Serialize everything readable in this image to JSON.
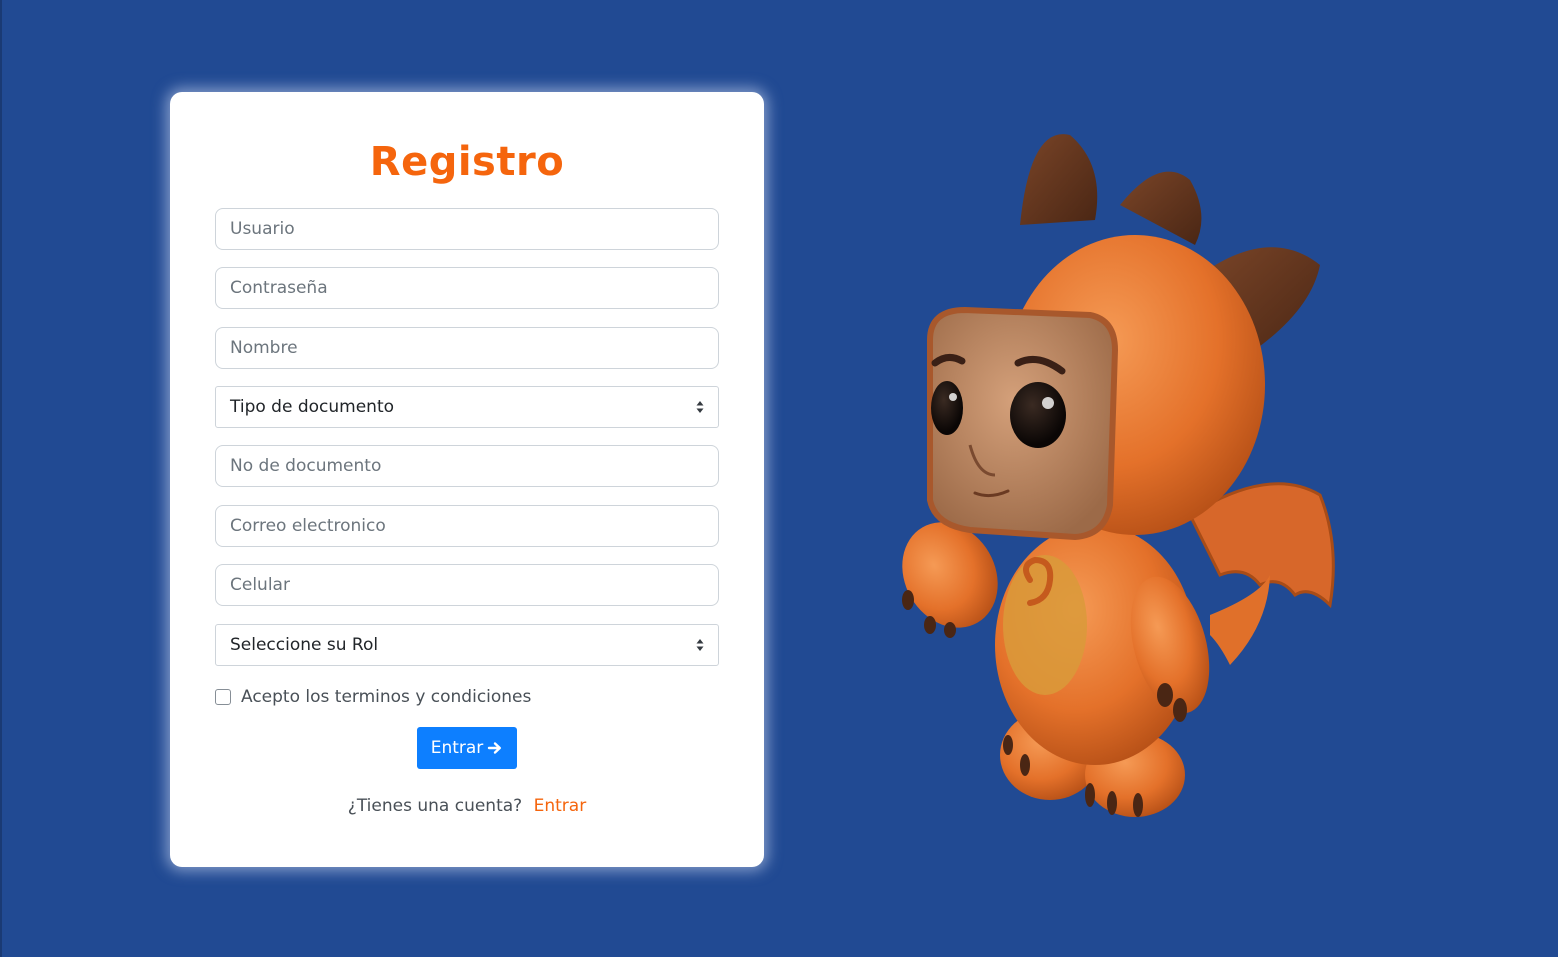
{
  "form": {
    "title": "Registro",
    "fields": {
      "usuario_placeholder": "Usuario",
      "contrasena_placeholder": "Contraseña",
      "nombre_placeholder": "Nombre",
      "tipo_documento_selected": "Tipo de documento",
      "no_documento_placeholder": "No de documento",
      "correo_placeholder": "Correo electronico",
      "celular_placeholder": "Celular",
      "rol_selected": "Seleccione su Rol"
    },
    "terms_label": "Acepto los terminos y condiciones",
    "terms_checked": false,
    "submit_label": "Entrar",
    "submit_icon": "arrow-right-icon",
    "footer_text": "¿Tienes una cuenta?",
    "footer_link": "Entrar"
  },
  "colors": {
    "background": "#214a93",
    "accent": "#f5650d",
    "button": "#0d7fff"
  },
  "illustration": {
    "icon": "orange-dragon-mascot"
  }
}
